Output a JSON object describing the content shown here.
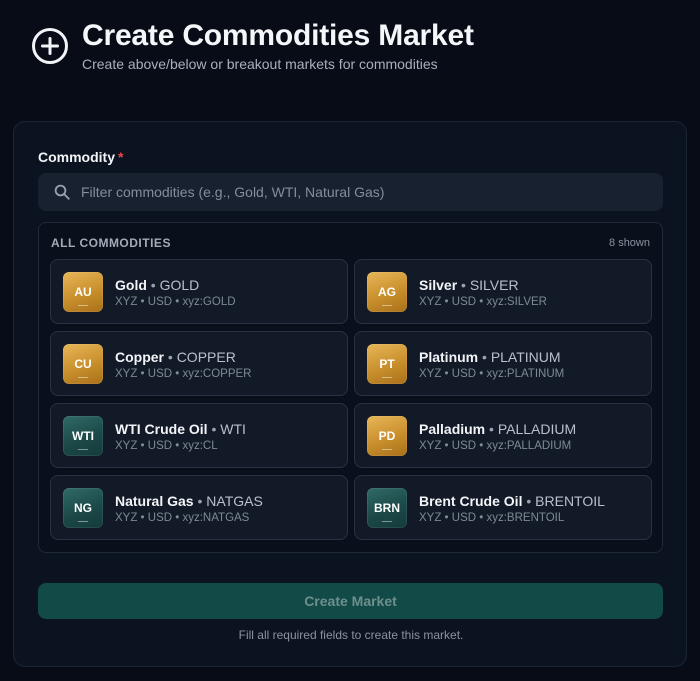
{
  "header": {
    "icon": "plus-circle-icon",
    "title": "Create Commodities Market",
    "subtitle": "Create above/below or breakout markets for commodities"
  },
  "form": {
    "commodity_label": "Commodity",
    "required_mark": "*",
    "search": {
      "icon": "search-icon",
      "placeholder": "Filter commodities (e.g., Gold, WTI, Natural Gas)",
      "value": ""
    },
    "list": {
      "heading": "ALL COMMODITIES",
      "count_label": "8 shown",
      "items": [
        {
          "badge": "AU",
          "name": "Gold",
          "sep": " • ",
          "ticker": "GOLD",
          "meta": "XYZ • USD • xyz:GOLD",
          "badge_color": "gold"
        },
        {
          "badge": "AG",
          "name": "Silver",
          "sep": " • ",
          "ticker": "SILVER",
          "meta": "XYZ • USD • xyz:SILVER",
          "badge_color": "gold"
        },
        {
          "badge": "CU",
          "name": "Copper",
          "sep": " • ",
          "ticker": "COPPER",
          "meta": "XYZ • USD • xyz:COPPER",
          "badge_color": "gold"
        },
        {
          "badge": "PT",
          "name": "Platinum",
          "sep": " • ",
          "ticker": "PLATINUM",
          "meta": "XYZ • USD • xyz:PLATINUM",
          "badge_color": "gold"
        },
        {
          "badge": "WTI",
          "name": "WTI Crude Oil",
          "sep": " • ",
          "ticker": "WTI",
          "meta": "XYZ • USD • xyz:CL",
          "badge_color": "teal"
        },
        {
          "badge": "PD",
          "name": "Palladium",
          "sep": " • ",
          "ticker": "PALLADIUM",
          "meta": "XYZ • USD • xyz:PALLADIUM",
          "badge_color": "gold"
        },
        {
          "badge": "NG",
          "name": "Natural Gas",
          "sep": " • ",
          "ticker": "NATGAS",
          "meta": "XYZ • USD • xyz:NATGAS",
          "badge_color": "teal"
        },
        {
          "badge": "BRN",
          "name": "Brent Crude Oil",
          "sep": " • ",
          "ticker": "BRENTOIL",
          "meta": "XYZ • USD • xyz:BRENTOIL",
          "badge_color": "teal"
        }
      ]
    },
    "create_button_label": "Create Market",
    "helper_text": "Fill all required fields to create this market."
  },
  "colors": {
    "background": "#070c17",
    "card": "#0c1320",
    "accent_button": "#114a47",
    "required": "#e5484d",
    "gold_badge": "#d19a35",
    "teal_badge": "#1f4f4d"
  }
}
